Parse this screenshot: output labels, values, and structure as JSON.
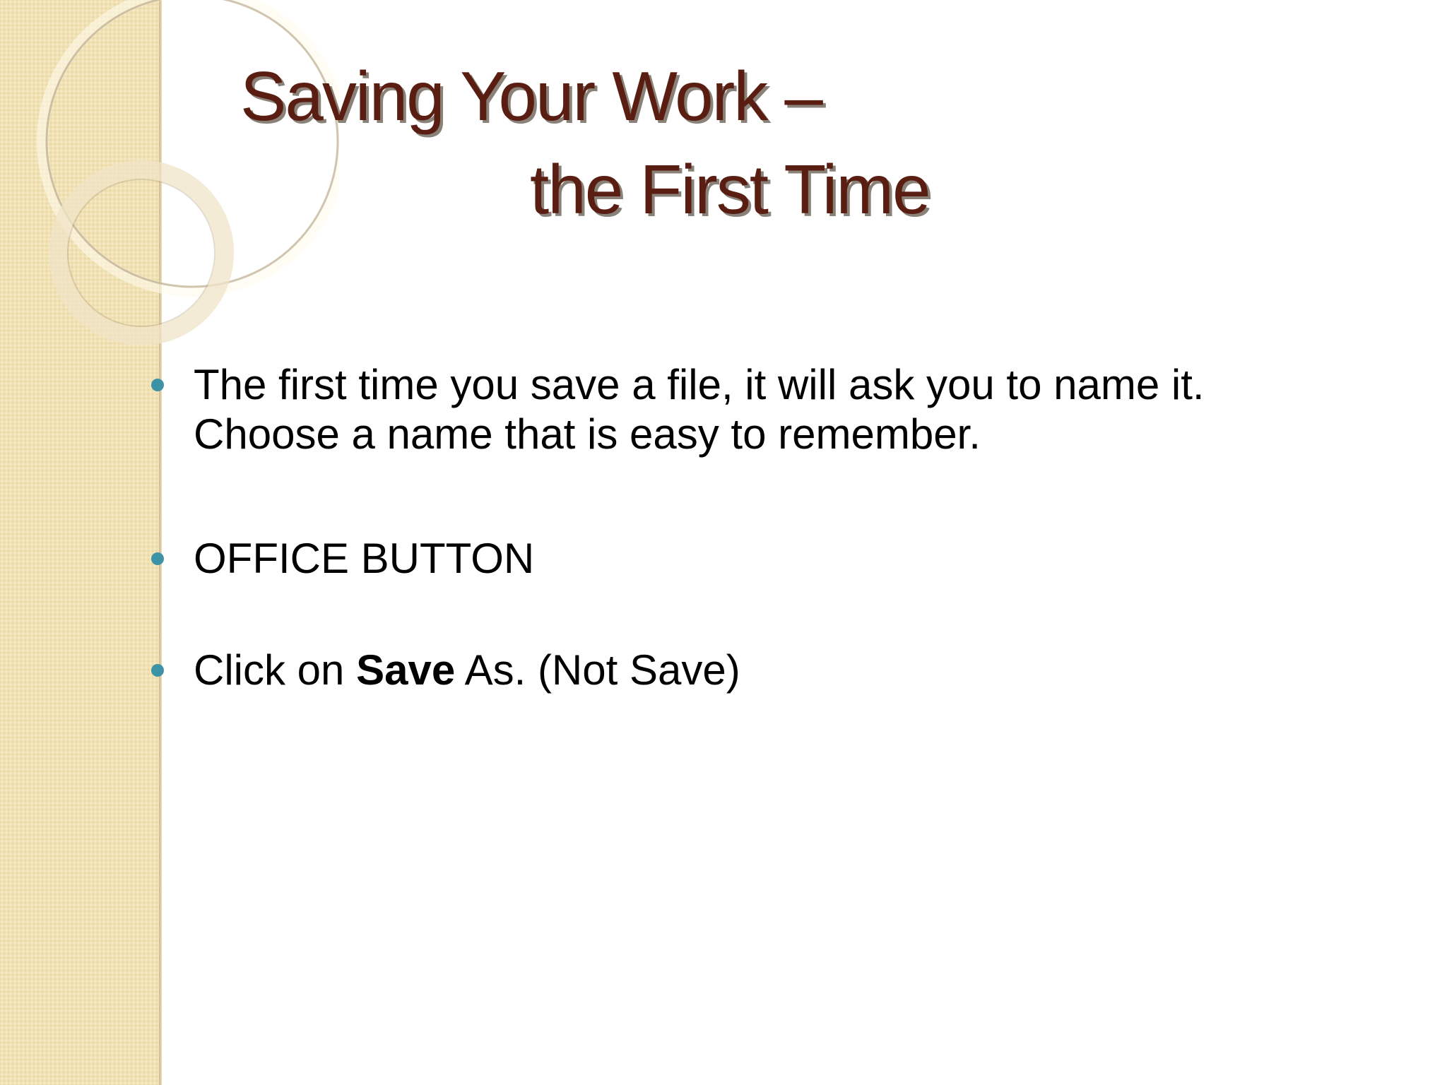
{
  "slide": {
    "title_line1": "Saving Your Work –",
    "title_line2": "the First Time",
    "bullets": [
      {
        "line1": "The first time you save a file, it will ask you to name it.",
        "line2": "Choose a name that is easy to remember."
      },
      {
        "text": "OFFICE BUTTON"
      },
      {
        "before": "Click on ",
        "bold": "Save",
        "after": " As.  (Not Save)"
      }
    ],
    "colors": {
      "title": "#5a1d12",
      "title_shadow": "#8a8178",
      "side_panel": "#f1e2b4",
      "bullet": "#3d93a6",
      "body_text": "#000000"
    },
    "decoration_icons": [
      "ring-decoration-large",
      "ring-decoration-small"
    ]
  }
}
